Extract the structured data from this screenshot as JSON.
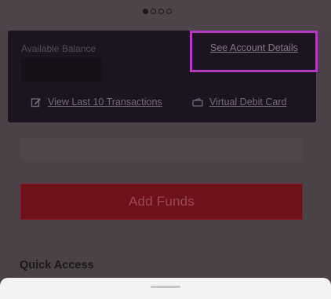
{
  "pager": {
    "count": 4,
    "active_index": 0
  },
  "account_card": {
    "balance_label": "Available Balance",
    "details_link": "See Account Details",
    "transactions_link": "View Last 10 Transactions",
    "debit_card_link": "Virtual Debit Card"
  },
  "actions": {
    "add_funds_label": "Add Funds"
  },
  "sections": {
    "quick_access_title": "Quick Access"
  },
  "colors": {
    "highlight": "#b13ac0",
    "primary_button": "#6d1219",
    "card_background": "#1c1421"
  },
  "icons": {
    "transactions": "edit-note-icon",
    "debit_card": "wallet-icon"
  }
}
